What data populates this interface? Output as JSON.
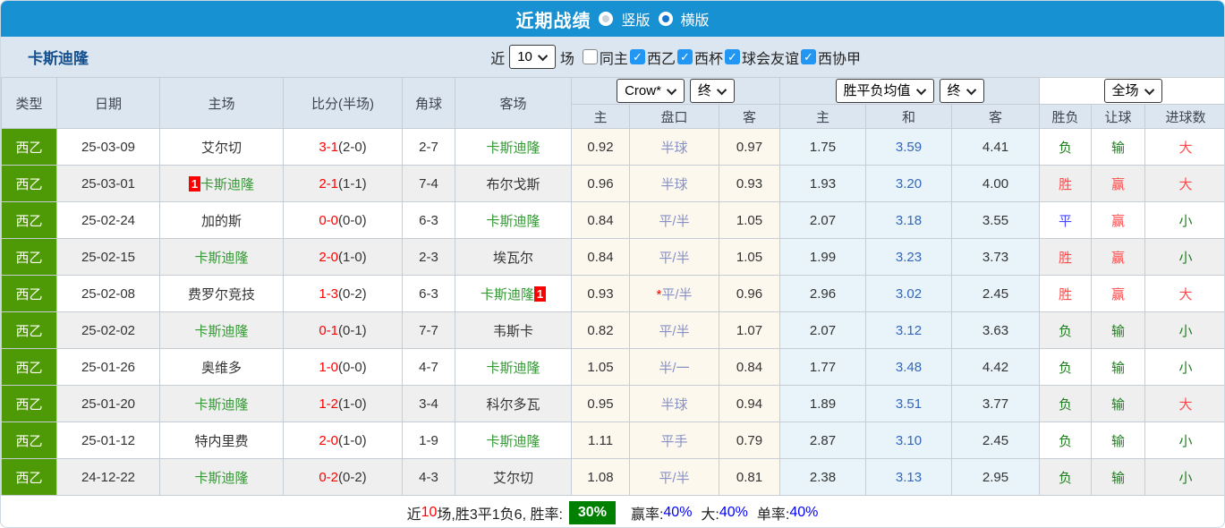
{
  "title_bar": {
    "title": "近期战绩",
    "radio_options": [
      {
        "label": "竖版",
        "selected": false
      },
      {
        "label": "横版",
        "selected": true
      }
    ]
  },
  "filter_bar": {
    "team_name": "卡斯迪隆",
    "recent_label": "近",
    "recent_count": "10",
    "games_label": "场",
    "checkboxes": [
      {
        "label": "同主",
        "checked": false
      },
      {
        "label": "西乙",
        "checked": true
      },
      {
        "label": "西杯",
        "checked": true
      },
      {
        "label": "球会友谊",
        "checked": true
      },
      {
        "label": "西协甲",
        "checked": true
      }
    ]
  },
  "table": {
    "static_headers": [
      "类型",
      "日期",
      "主场",
      "比分(半场)",
      "角球",
      "客场"
    ],
    "groups": [
      {
        "dropdowns": [
          "Crow*",
          "终"
        ],
        "sub": [
          "主",
          "盘口",
          "客"
        ]
      },
      {
        "dropdowns": [
          "胜平负均值",
          "终"
        ],
        "sub": [
          "主",
          "和",
          "客"
        ]
      },
      {
        "dropdowns": [
          "全场"
        ],
        "sub": [
          "胜负",
          "让球",
          "进球数"
        ]
      }
    ],
    "rows": [
      {
        "league": "西乙",
        "date": "25-03-09",
        "home": {
          "name": "艾尔切",
          "self": false,
          "badge": "",
          "badge_pos": ""
        },
        "score": {
          "ft": "3-1",
          "ht": "(2-0)"
        },
        "corners": "2-7",
        "away": {
          "name": "卡斯迪隆",
          "self": true,
          "badge": "",
          "badge_pos": ""
        },
        "handicap": {
          "home": "0.92",
          "line": "半球",
          "star": false,
          "away": "0.97"
        },
        "avg": {
          "home": "1.75",
          "draw": "3.59",
          "away": "4.41"
        },
        "result": {
          "t": "负",
          "c": "green"
        },
        "cover": {
          "t": "输",
          "c": "green"
        },
        "goals": {
          "t": "大",
          "c": "red"
        }
      },
      {
        "league": "西乙",
        "date": "25-03-01",
        "home": {
          "name": "卡斯迪隆",
          "self": true,
          "badge": "1",
          "badge_pos": "before"
        },
        "score": {
          "ft": "2-1",
          "ht": "(1-1)"
        },
        "corners": "7-4",
        "away": {
          "name": "布尔戈斯",
          "self": false,
          "badge": "",
          "badge_pos": ""
        },
        "handicap": {
          "home": "0.96",
          "line": "半球",
          "star": false,
          "away": "0.93"
        },
        "avg": {
          "home": "1.93",
          "draw": "3.20",
          "away": "4.00"
        },
        "result": {
          "t": "胜",
          "c": "red"
        },
        "cover": {
          "t": "赢",
          "c": "red"
        },
        "goals": {
          "t": "大",
          "c": "red"
        }
      },
      {
        "league": "西乙",
        "date": "25-02-24",
        "home": {
          "name": "加的斯",
          "self": false,
          "badge": "",
          "badge_pos": ""
        },
        "score": {
          "ft": "0-0",
          "ht": "(0-0)"
        },
        "corners": "6-3",
        "away": {
          "name": "卡斯迪隆",
          "self": true,
          "badge": "",
          "badge_pos": ""
        },
        "handicap": {
          "home": "0.84",
          "line": "平/半",
          "star": false,
          "away": "1.05"
        },
        "avg": {
          "home": "2.07",
          "draw": "3.18",
          "away": "3.55"
        },
        "result": {
          "t": "平",
          "c": "blue"
        },
        "cover": {
          "t": "赢",
          "c": "red"
        },
        "goals": {
          "t": "小",
          "c": "green"
        }
      },
      {
        "league": "西乙",
        "date": "25-02-15",
        "home": {
          "name": "卡斯迪隆",
          "self": true,
          "badge": "",
          "badge_pos": ""
        },
        "score": {
          "ft": "2-0",
          "ht": "(1-0)"
        },
        "corners": "2-3",
        "away": {
          "name": "埃瓦尔",
          "self": false,
          "badge": "",
          "badge_pos": ""
        },
        "handicap": {
          "home": "0.84",
          "line": "平/半",
          "star": false,
          "away": "1.05"
        },
        "avg": {
          "home": "1.99",
          "draw": "3.23",
          "away": "3.73"
        },
        "result": {
          "t": "胜",
          "c": "red"
        },
        "cover": {
          "t": "赢",
          "c": "red"
        },
        "goals": {
          "t": "小",
          "c": "green"
        }
      },
      {
        "league": "西乙",
        "date": "25-02-08",
        "home": {
          "name": "费罗尔竞技",
          "self": false,
          "badge": "",
          "badge_pos": ""
        },
        "score": {
          "ft": "1-3",
          "ht": "(0-2)"
        },
        "corners": "6-3",
        "away": {
          "name": "卡斯迪隆",
          "self": true,
          "badge": "1",
          "badge_pos": "after"
        },
        "handicap": {
          "home": "0.93",
          "line": "平/半",
          "star": true,
          "away": "0.96"
        },
        "avg": {
          "home": "2.96",
          "draw": "3.02",
          "away": "2.45"
        },
        "result": {
          "t": "胜",
          "c": "red"
        },
        "cover": {
          "t": "赢",
          "c": "red"
        },
        "goals": {
          "t": "大",
          "c": "red"
        }
      },
      {
        "league": "西乙",
        "date": "25-02-02",
        "home": {
          "name": "卡斯迪隆",
          "self": true,
          "badge": "",
          "badge_pos": ""
        },
        "score": {
          "ft": "0-1",
          "ht": "(0-1)"
        },
        "corners": "7-7",
        "away": {
          "name": "韦斯卡",
          "self": false,
          "badge": "",
          "badge_pos": ""
        },
        "handicap": {
          "home": "0.82",
          "line": "平/半",
          "star": false,
          "away": "1.07"
        },
        "avg": {
          "home": "2.07",
          "draw": "3.12",
          "away": "3.63"
        },
        "result": {
          "t": "负",
          "c": "green"
        },
        "cover": {
          "t": "输",
          "c": "green"
        },
        "goals": {
          "t": "小",
          "c": "green"
        }
      },
      {
        "league": "西乙",
        "date": "25-01-26",
        "home": {
          "name": "奥维多",
          "self": false,
          "badge": "",
          "badge_pos": ""
        },
        "score": {
          "ft": "1-0",
          "ht": "(0-0)"
        },
        "corners": "4-7",
        "away": {
          "name": "卡斯迪隆",
          "self": true,
          "badge": "",
          "badge_pos": ""
        },
        "handicap": {
          "home": "1.05",
          "line": "半/一",
          "star": false,
          "away": "0.84"
        },
        "avg": {
          "home": "1.77",
          "draw": "3.48",
          "away": "4.42"
        },
        "result": {
          "t": "负",
          "c": "green"
        },
        "cover": {
          "t": "输",
          "c": "green"
        },
        "goals": {
          "t": "小",
          "c": "green"
        }
      },
      {
        "league": "西乙",
        "date": "25-01-20",
        "home": {
          "name": "卡斯迪隆",
          "self": true,
          "badge": "",
          "badge_pos": ""
        },
        "score": {
          "ft": "1-2",
          "ht": "(1-0)"
        },
        "corners": "3-4",
        "away": {
          "name": "科尔多瓦",
          "self": false,
          "badge": "",
          "badge_pos": ""
        },
        "handicap": {
          "home": "0.95",
          "line": "半球",
          "star": false,
          "away": "0.94"
        },
        "avg": {
          "home": "1.89",
          "draw": "3.51",
          "away": "3.77"
        },
        "result": {
          "t": "负",
          "c": "green"
        },
        "cover": {
          "t": "输",
          "c": "green"
        },
        "goals": {
          "t": "大",
          "c": "red"
        }
      },
      {
        "league": "西乙",
        "date": "25-01-12",
        "home": {
          "name": "特内里费",
          "self": false,
          "badge": "",
          "badge_pos": ""
        },
        "score": {
          "ft": "2-0",
          "ht": "(1-0)"
        },
        "corners": "1-9",
        "away": {
          "name": "卡斯迪隆",
          "self": true,
          "badge": "",
          "badge_pos": ""
        },
        "handicap": {
          "home": "1.11",
          "line": "平手",
          "star": false,
          "away": "0.79"
        },
        "avg": {
          "home": "2.87",
          "draw": "3.10",
          "away": "2.45"
        },
        "result": {
          "t": "负",
          "c": "green"
        },
        "cover": {
          "t": "输",
          "c": "green"
        },
        "goals": {
          "t": "小",
          "c": "green"
        }
      },
      {
        "league": "西乙",
        "date": "24-12-22",
        "home": {
          "name": "卡斯迪隆",
          "self": true,
          "badge": "",
          "badge_pos": ""
        },
        "score": {
          "ft": "0-2",
          "ht": "(0-2)"
        },
        "corners": "4-3",
        "away": {
          "name": "艾尔切",
          "self": false,
          "badge": "",
          "badge_pos": ""
        },
        "handicap": {
          "home": "1.08",
          "line": "平/半",
          "star": false,
          "away": "0.81"
        },
        "avg": {
          "home": "2.38",
          "draw": "3.13",
          "away": "2.95"
        },
        "result": {
          "t": "负",
          "c": "green"
        },
        "cover": {
          "t": "输",
          "c": "green"
        },
        "goals": {
          "t": "小",
          "c": "green"
        }
      }
    ]
  },
  "footer": {
    "prefix": "近",
    "count": "10",
    "suffix": "场,胜3平1负6, 胜率:",
    "win_rate": "30%",
    "segments": [
      {
        "label": "赢率:",
        "value": "40%"
      },
      {
        "label": "大:",
        "value": "40%"
      },
      {
        "label": "单率:",
        "value": "40%"
      }
    ]
  },
  "colors": {
    "titlebar_blue": "#1791d2",
    "band_bg": "#dce6f1",
    "row_stripe": "#efefef",
    "handicap_col_bg": "#fcf8ee",
    "avg_col_bg": "#e9f4fa",
    "league_green": "#4e9a06",
    "self_team_green": "#339933",
    "score_red": "#ff0000",
    "draw_odds_blue": "#3366bb",
    "handicap_text_blue": "#8891c6",
    "win_red": "#ff4a4a",
    "lose_green": "#1e7d1e",
    "level_blue": "#4646ff",
    "rate_badge_green": "#008000",
    "footer_value_blue": "#0000ff",
    "badge_red": "#ff0000",
    "checkbox_blue": "#2196f3"
  }
}
